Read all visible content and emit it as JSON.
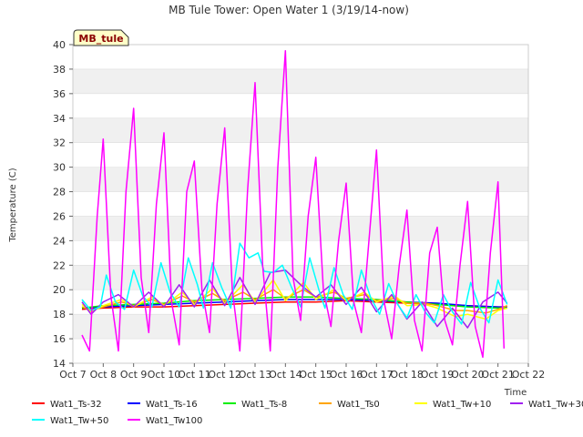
{
  "chart_data": {
    "type": "line",
    "title": "MB Tule Tower: Open Water 1 (3/19/14-now)",
    "site_badge": "MB_tule",
    "xlabel": "Time",
    "ylabel": "Temperature (C)",
    "xlim": [
      7,
      22
    ],
    "ylim": [
      14,
      40
    ],
    "x_ticks": [
      {
        "v": 7,
        "label": "Oct 7"
      },
      {
        "v": 8,
        "label": "Oct 8"
      },
      {
        "v": 9,
        "label": "Oct 9"
      },
      {
        "v": 10,
        "label": "Oct 10"
      },
      {
        "v": 11,
        "label": "Oct 11"
      },
      {
        "v": 12,
        "label": "Oct 12"
      },
      {
        "v": 13,
        "label": "Oct 13"
      },
      {
        "v": 14,
        "label": "Oct 14"
      },
      {
        "v": 15,
        "label": "Oct 15"
      },
      {
        "v": 16,
        "label": "Oct 16"
      },
      {
        "v": 17,
        "label": "Oct 17"
      },
      {
        "v": 18,
        "label": "Oct 18"
      },
      {
        "v": 19,
        "label": "Oct 19"
      },
      {
        "v": 20,
        "label": "Oct 20"
      },
      {
        "v": 21,
        "label": "Oct 21"
      },
      {
        "v": 22,
        "label": "Oct 22"
      }
    ],
    "y_ticks": [
      14,
      16,
      18,
      20,
      22,
      24,
      26,
      28,
      30,
      32,
      34,
      36,
      38,
      40
    ],
    "grid": "horizontal bands",
    "legend_position": "bottom",
    "series": [
      {
        "name": "Wat1_Ts-32",
        "color": "#ff0000",
        "x": [
          7.3,
          8,
          9,
          10,
          11,
          12,
          13,
          14,
          15,
          16,
          17,
          18,
          19,
          20,
          21,
          21.3
        ],
        "y": [
          18.4,
          18.5,
          18.6,
          18.6,
          18.7,
          18.8,
          18.9,
          19.0,
          19.0,
          19.1,
          19.0,
          18.9,
          18.8,
          18.7,
          18.6,
          18.6
        ]
      },
      {
        "name": "Wat1_Ts-16",
        "color": "#0000ff",
        "x": [
          7.3,
          8,
          9,
          10,
          11,
          12,
          13,
          14,
          15,
          16,
          17,
          18,
          19,
          20,
          21,
          21.3
        ],
        "y": [
          18.5,
          18.6,
          18.7,
          18.8,
          18.9,
          19.0,
          19.1,
          19.2,
          19.2,
          19.2,
          19.1,
          19.0,
          18.9,
          18.7,
          18.6,
          18.6
        ]
      },
      {
        "name": "Wat1_Ts-8",
        "color": "#00ee00",
        "x": [
          7.3,
          8,
          9,
          10,
          11,
          12,
          13,
          14,
          15,
          16,
          17,
          18,
          19,
          20,
          21,
          21.3
        ],
        "y": [
          18.5,
          18.7,
          18.8,
          18.9,
          19.1,
          19.2,
          19.3,
          19.4,
          19.4,
          19.3,
          19.2,
          19.0,
          18.8,
          18.6,
          18.5,
          18.5
        ]
      },
      {
        "name": "Wat1_Ts0",
        "color": "#ffa500",
        "x": [
          7.3,
          7.6,
          8,
          8.6,
          9,
          9.6,
          10,
          10.6,
          11,
          11.6,
          12,
          12.6,
          13,
          13.6,
          14,
          14.6,
          15,
          15.6,
          16,
          16.6,
          17,
          17.6,
          18,
          18.6,
          19,
          19.6,
          20,
          20.6,
          21,
          21.3
        ],
        "y": [
          18.6,
          18.3,
          18.6,
          19.0,
          18.7,
          19.2,
          18.8,
          19.5,
          19.0,
          19.7,
          19.1,
          19.8,
          19.2,
          20.0,
          19.3,
          20.0,
          19.4,
          19.8,
          19.3,
          19.6,
          19.1,
          19.3,
          18.9,
          18.9,
          18.7,
          18.3,
          18.3,
          18.1,
          18.4,
          18.7
        ]
      },
      {
        "name": "Wat1_Tw+10",
        "color": "#ffff00",
        "x": [
          7.3,
          7.6,
          8,
          8.6,
          9,
          9.6,
          10,
          10.6,
          11,
          11.6,
          12,
          12.6,
          13,
          13.6,
          14,
          14.6,
          15,
          15.6,
          16,
          16.6,
          17,
          17.6,
          18,
          18.6,
          19,
          19.6,
          20,
          20.6,
          21,
          21.3
        ],
        "y": [
          18.8,
          18.2,
          18.7,
          19.2,
          18.6,
          19.4,
          18.7,
          19.8,
          18.8,
          20.1,
          18.9,
          20.4,
          19.0,
          20.8,
          19.1,
          20.6,
          19.2,
          20.0,
          19.1,
          19.8,
          19.0,
          19.5,
          18.7,
          18.8,
          18.5,
          17.8,
          18.0,
          17.6,
          18.3,
          18.5
        ]
      },
      {
        "name": "Wat1_Tw+30",
        "color": "#a020f0",
        "x": [
          7.3,
          7.6,
          8,
          8.5,
          9,
          9.5,
          10,
          10.5,
          11,
          11.5,
          12,
          12.5,
          13,
          13.5,
          14,
          14.5,
          15,
          15.5,
          16,
          16.5,
          17,
          17.5,
          18,
          18.5,
          19,
          19.5,
          20,
          20.5,
          21,
          21.3
        ],
        "y": [
          19.0,
          18.0,
          19.0,
          19.6,
          18.6,
          19.8,
          18.6,
          20.4,
          18.6,
          20.8,
          18.7,
          21.0,
          18.8,
          21.4,
          21.6,
          20.4,
          19.4,
          20.4,
          18.8,
          20.2,
          18.2,
          19.6,
          17.6,
          19.0,
          17.0,
          18.5,
          16.9,
          19.0,
          19.8,
          18.9
        ]
      },
      {
        "name": "Wat1_Tw+50",
        "color": "#00ffff",
        "x": [
          7.3,
          7.6,
          7.9,
          8.1,
          8.4,
          8.7,
          9.0,
          9.3,
          9.6,
          9.9,
          10.2,
          10.5,
          10.8,
          11.1,
          11.3,
          11.6,
          11.9,
          12.2,
          12.5,
          12.8,
          13.1,
          13.3,
          13.6,
          13.9,
          14.2,
          14.5,
          14.8,
          15.1,
          15.3,
          15.6,
          15.9,
          16.2,
          16.5,
          16.8,
          17.1,
          17.4,
          17.7,
          18.0,
          18.3,
          18.6,
          18.9,
          19.2,
          19.5,
          19.8,
          20.1,
          20.4,
          20.7,
          21.0,
          21.3
        ],
        "y": [
          19.2,
          18.3,
          18.6,
          21.2,
          19.0,
          18.4,
          21.6,
          19.5,
          18.6,
          22.2,
          19.8,
          18.6,
          22.6,
          20.4,
          18.5,
          22.2,
          20.2,
          18.5,
          23.8,
          22.6,
          23.0,
          21.5,
          21.4,
          22.0,
          20.2,
          18.6,
          22.6,
          20.0,
          18.5,
          21.8,
          19.6,
          18.4,
          21.6,
          19.4,
          18.0,
          20.5,
          18.8,
          17.7,
          19.6,
          18.2,
          17.3,
          19.6,
          18.2,
          17.2,
          20.6,
          18.5,
          17.3,
          20.8,
          18.8
        ]
      },
      {
        "name": "Wat1_Tw100",
        "color": "#ff00ff",
        "x": [
          7.3,
          7.55,
          7.8,
          8.0,
          8.25,
          8.5,
          8.75,
          9.0,
          9.25,
          9.5,
          9.75,
          10.0,
          10.25,
          10.5,
          10.75,
          11.0,
          11.25,
          11.5,
          11.75,
          12.0,
          12.25,
          12.5,
          12.75,
          13.0,
          13.25,
          13.5,
          13.75,
          14.0,
          14.25,
          14.5,
          14.75,
          15.0,
          15.25,
          15.5,
          15.75,
          16.0,
          16.25,
          16.5,
          16.75,
          17.0,
          17.25,
          17.5,
          17.75,
          18.0,
          18.25,
          18.5,
          18.75,
          19.0,
          19.25,
          19.5,
          19.75,
          20.0,
          20.25,
          20.5,
          20.75,
          21.0,
          21.2
        ],
        "y": [
          16.3,
          15.0,
          26.0,
          32.3,
          19.5,
          15.0,
          28.0,
          34.8,
          21.0,
          16.5,
          27.0,
          32.8,
          19.0,
          15.5,
          28.0,
          30.5,
          20.0,
          16.5,
          27.0,
          33.2,
          20.0,
          15.0,
          28.0,
          36.9,
          22.0,
          15.0,
          30.0,
          39.5,
          21.0,
          17.5,
          26.0,
          30.8,
          20.0,
          17.0,
          24.0,
          28.7,
          19.0,
          16.5,
          24.0,
          31.4,
          19.0,
          16.0,
          22.0,
          26.5,
          17.5,
          15.0,
          23.0,
          25.1,
          17.5,
          15.5,
          22.0,
          27.2,
          17.0,
          14.5,
          23.0,
          28.8,
          15.2
        ]
      }
    ]
  }
}
